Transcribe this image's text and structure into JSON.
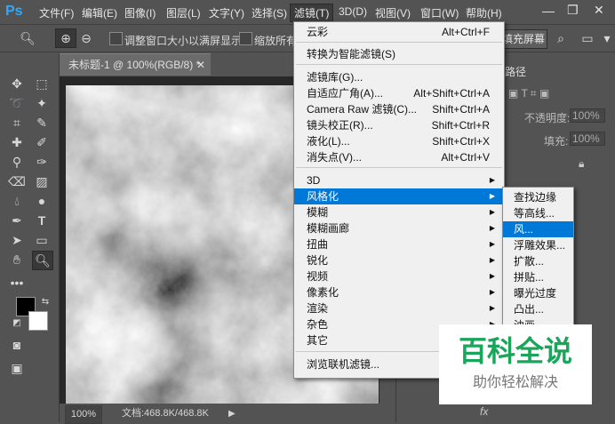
{
  "app": {
    "logo": "Ps"
  },
  "menubar": {
    "items": [
      "文件(F)",
      "编辑(E)",
      "图像(I)",
      "图层(L)",
      "文字(Y)",
      "选择(S)",
      "滤镜(T)",
      "3D(D)",
      "视图(V)",
      "窗口(W)",
      "帮助(H)"
    ],
    "active": "滤镜(T)"
  },
  "options": {
    "resize_windows": "调整窗口大小以满屏显示",
    "zoom_all": "缩放所有",
    "fill_screen": "填充屏幕"
  },
  "document": {
    "tab_title": "未标题-1 @ 100%(RGB/8) *",
    "zoom": "100%",
    "doc_info": "文档:468.8K/468.8K"
  },
  "panel": {
    "tab_paths": "路径",
    "opacity_label": "不透明度:",
    "opacity_value": "100%",
    "fill_label": "填充:",
    "fill_value": "100%",
    "fx_label": "fx"
  },
  "filter_menu": {
    "items": [
      {
        "label": "云彩",
        "shortcut": "Alt+Ctrl+F"
      },
      {
        "label": "转换为智能滤镜(S)",
        "shortcut": ""
      },
      {
        "label": "滤镜库(G)...",
        "shortcut": ""
      },
      {
        "label": "自适应广角(A)...",
        "shortcut": "Alt+Shift+Ctrl+A"
      },
      {
        "label": "Camera Raw 滤镜(C)...",
        "shortcut": "Shift+Ctrl+A"
      },
      {
        "label": "镜头校正(R)...",
        "shortcut": "Shift+Ctrl+R"
      },
      {
        "label": "液化(L)...",
        "shortcut": "Shift+Ctrl+X"
      },
      {
        "label": "消失点(V)...",
        "shortcut": "Alt+Ctrl+V"
      },
      {
        "label": "3D",
        "shortcut": ""
      },
      {
        "label": "风格化",
        "shortcut": ""
      },
      {
        "label": "模糊",
        "shortcut": ""
      },
      {
        "label": "模糊画廊",
        "shortcut": ""
      },
      {
        "label": "扭曲",
        "shortcut": ""
      },
      {
        "label": "锐化",
        "shortcut": ""
      },
      {
        "label": "视频",
        "shortcut": ""
      },
      {
        "label": "像素化",
        "shortcut": ""
      },
      {
        "label": "渲染",
        "shortcut": ""
      },
      {
        "label": "杂色",
        "shortcut": ""
      },
      {
        "label": "其它",
        "shortcut": ""
      },
      {
        "label": "浏览联机滤镜...",
        "shortcut": ""
      }
    ],
    "highlighted": "风格化"
  },
  "stylize_submenu": {
    "items": [
      "查找边缘",
      "等高线...",
      "风...",
      "浮雕效果...",
      "扩散...",
      "拼贴...",
      "曝光过度",
      "凸出...",
      "油画..."
    ],
    "highlighted": "风..."
  },
  "watermark": {
    "title": "百科全说",
    "subtitle": "助你轻松解决",
    "title_color": "#1aa55a"
  },
  "colors": {
    "highlight": "#0078d7",
    "ps_blue": "#31a8ff"
  }
}
